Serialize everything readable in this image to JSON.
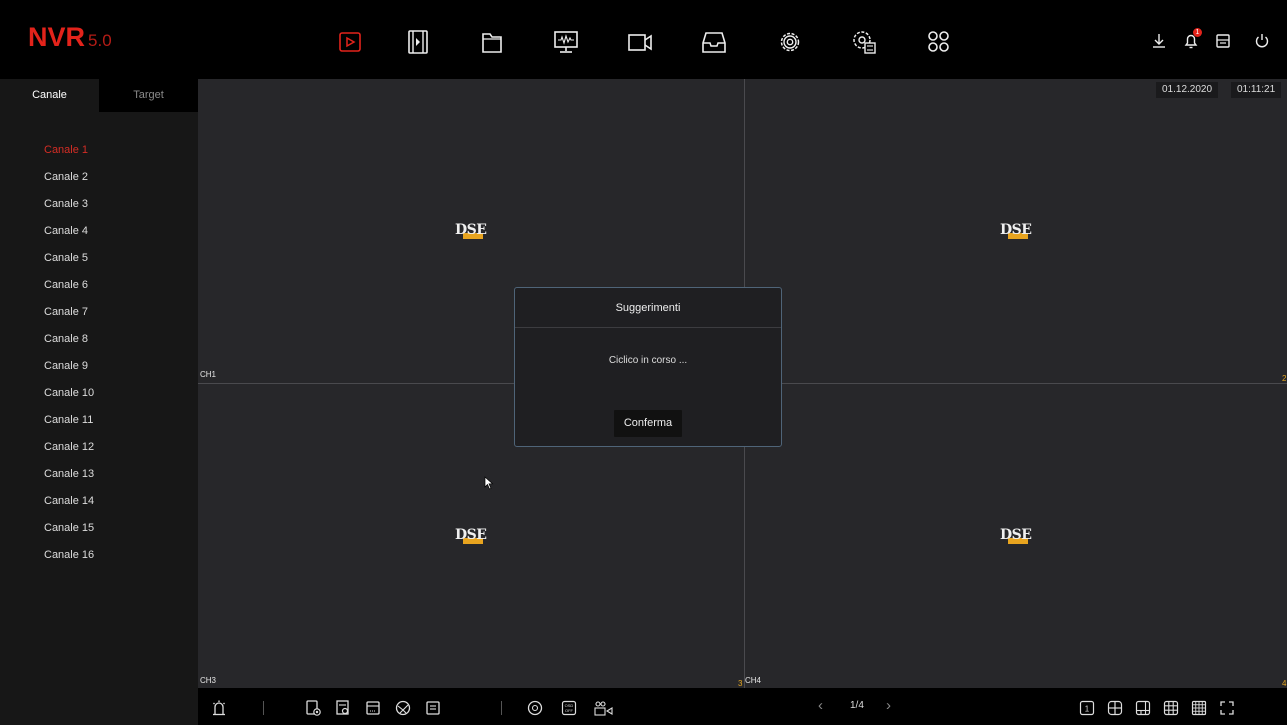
{
  "app": {
    "logo_main": "NVR",
    "logo_version": "5.0"
  },
  "topnav": [
    {
      "name": "playback-icon"
    },
    {
      "name": "video-clip-icon"
    },
    {
      "name": "files-icon"
    },
    {
      "name": "monitor-icon"
    },
    {
      "name": "camera-icon"
    },
    {
      "name": "storage-icon"
    },
    {
      "name": "settings-icon"
    },
    {
      "name": "advanced-settings-icon"
    },
    {
      "name": "apps-icon"
    }
  ],
  "topright": {
    "alarm_count": "1"
  },
  "sidebar": {
    "tabs": [
      "Canale",
      "Target"
    ],
    "channels": [
      "Canale 1",
      "Canale 2",
      "Canale 3",
      "Canale 4",
      "Canale 5",
      "Canale 6",
      "Canale 7",
      "Canale 8",
      "Canale 9",
      "Canale 10",
      "Canale 11",
      "Canale 12",
      "Canale 13",
      "Canale 14",
      "Canale 15",
      "Canale 16"
    ],
    "active_channel_index": 0
  },
  "grid": {
    "date": "01.12.2020",
    "time": "01:11:21",
    "cells": [
      {
        "label": "CH1",
        "number": ""
      },
      {
        "label": "",
        "number": "2"
      },
      {
        "label": "CH3",
        "number": "3"
      },
      {
        "label": "CH4",
        "number": "4"
      }
    ],
    "watermark_text": "DSE"
  },
  "dialog": {
    "title": "Suggerimenti",
    "message": "Ciclico in corso ...",
    "button": "Conferma"
  },
  "bottombar": {
    "page": "1/4"
  },
  "colors": {
    "accent": "#e3231b",
    "highlight": "#d42d25",
    "dialog_border": "#4f6478"
  }
}
